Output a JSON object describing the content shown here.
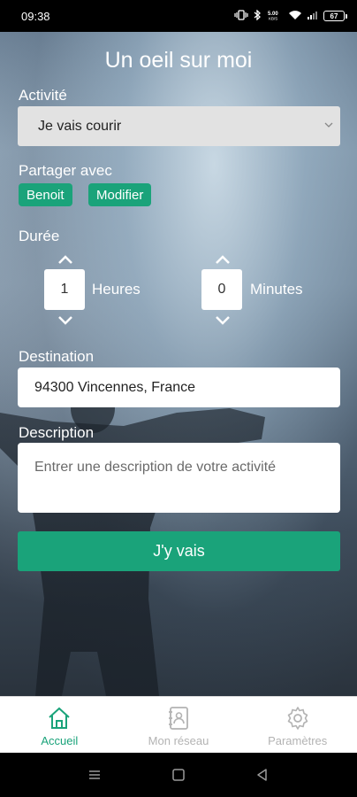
{
  "status_bar": {
    "time": "09:38",
    "network": "5.00 KB/S",
    "battery": "67"
  },
  "header": {
    "title": "Un oeil sur moi"
  },
  "activity": {
    "label": "Activité",
    "selected": "Je vais courir"
  },
  "share": {
    "label": "Partager avec",
    "contact": "Benoit",
    "modify_label": "Modifier"
  },
  "duration": {
    "label": "Durée",
    "hours_value": "1",
    "hours_label": "Heures",
    "minutes_value": "0",
    "minutes_label": "Minutes"
  },
  "destination": {
    "label": "Destination",
    "value": "94300 Vincennes, France"
  },
  "description": {
    "label": "Description",
    "placeholder": "Entrer une description de votre activité"
  },
  "submit_label": "J'y vais",
  "tabs": [
    {
      "label": "Accueil",
      "icon": "home-icon",
      "active": true
    },
    {
      "label": "Mon réseau",
      "icon": "contacts-icon",
      "active": false
    },
    {
      "label": "Paramètres",
      "icon": "gear-icon",
      "active": false
    }
  ],
  "colors": {
    "accent": "#1aa37a",
    "tab_inactive": "#b3b3b3"
  }
}
